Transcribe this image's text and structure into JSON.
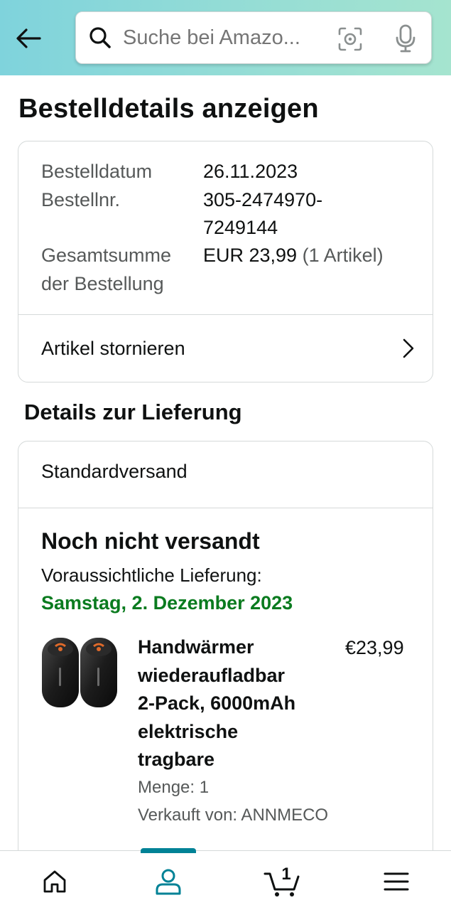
{
  "header": {
    "search_placeholder": "Suche bei Amazo...",
    "icons": [
      "back-arrow-icon",
      "search-icon",
      "camera-lens-icon",
      "microphone-icon"
    ]
  },
  "page": {
    "title": "Bestelldetails anzeigen"
  },
  "order_summary": {
    "date_label": "Bestelldatum",
    "date_value": "26.11.2023",
    "number_label": "Bestellnr.",
    "number_value_line1": "305-2474970-",
    "number_value_line2": "7249144",
    "total_label_line1": "Gesamtsumme",
    "total_label_line2": "der Bestellung",
    "total_value": "EUR 23,99",
    "total_items": "(1 Artikel)",
    "cancel_link": "Artikel stornieren"
  },
  "delivery": {
    "section_title": "Details zur Lieferung",
    "shipping_type": "Standardversand",
    "status": "Noch nicht versandt",
    "estimate_label": "Voraussichtliche Lieferung:",
    "estimate_date": "Samstag, 2. Dezember 2023",
    "item": {
      "title_lines": [
        "Handwärmer",
        "wiederaufladbar",
        "2-Pack, 6000mAh",
        "elektrische",
        "tragbare"
      ],
      "price": "€23,99",
      "quantity": "Menge: 1",
      "seller": "Verkauft von: ANNMECO"
    }
  },
  "bottom_nav": {
    "cart_count": "1",
    "active_tab": "account",
    "items": [
      "home-icon",
      "account-icon",
      "cart-icon",
      "menu-icon"
    ]
  },
  "colors": {
    "accent_teal": "#008296",
    "delivery_green": "#0a7b1f",
    "header_gradient_start": "#7fd3dc",
    "header_gradient_end": "#a5e4cf"
  }
}
